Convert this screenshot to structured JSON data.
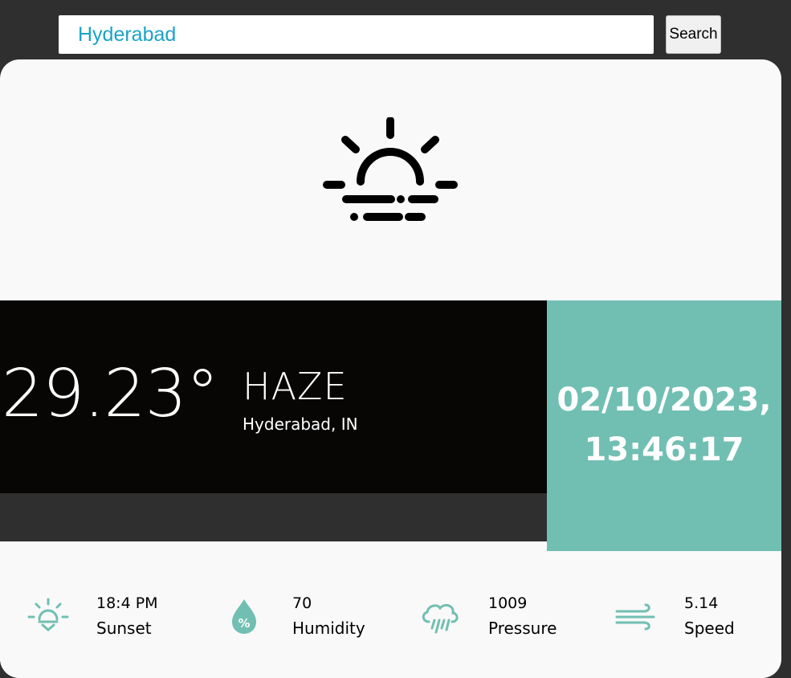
{
  "search": {
    "value": "Hyderabad",
    "button_label": "Search"
  },
  "weather": {
    "icon": "haze-icon",
    "temperature": "29.23°",
    "condition": "HAZE",
    "location": "Hyderabad, IN"
  },
  "datetime": {
    "date": "02/10/2023,",
    "time": "13:46:17"
  },
  "details": [
    {
      "icon": "sunset-icon",
      "value": "18:4 PM",
      "label": "Sunset"
    },
    {
      "icon": "humidity-icon",
      "value": "70",
      "label": "Humidity"
    },
    {
      "icon": "pressure-icon",
      "value": "1009",
      "label": "Pressure"
    },
    {
      "icon": "wind-icon",
      "value": "5.14",
      "label": "Speed"
    }
  ],
  "colors": {
    "background": "#2f2f2f",
    "card": "#f9f9f9",
    "temp_panel": "#070605",
    "accent": "#71bfb2",
    "search_text": "#1ba3c6"
  }
}
